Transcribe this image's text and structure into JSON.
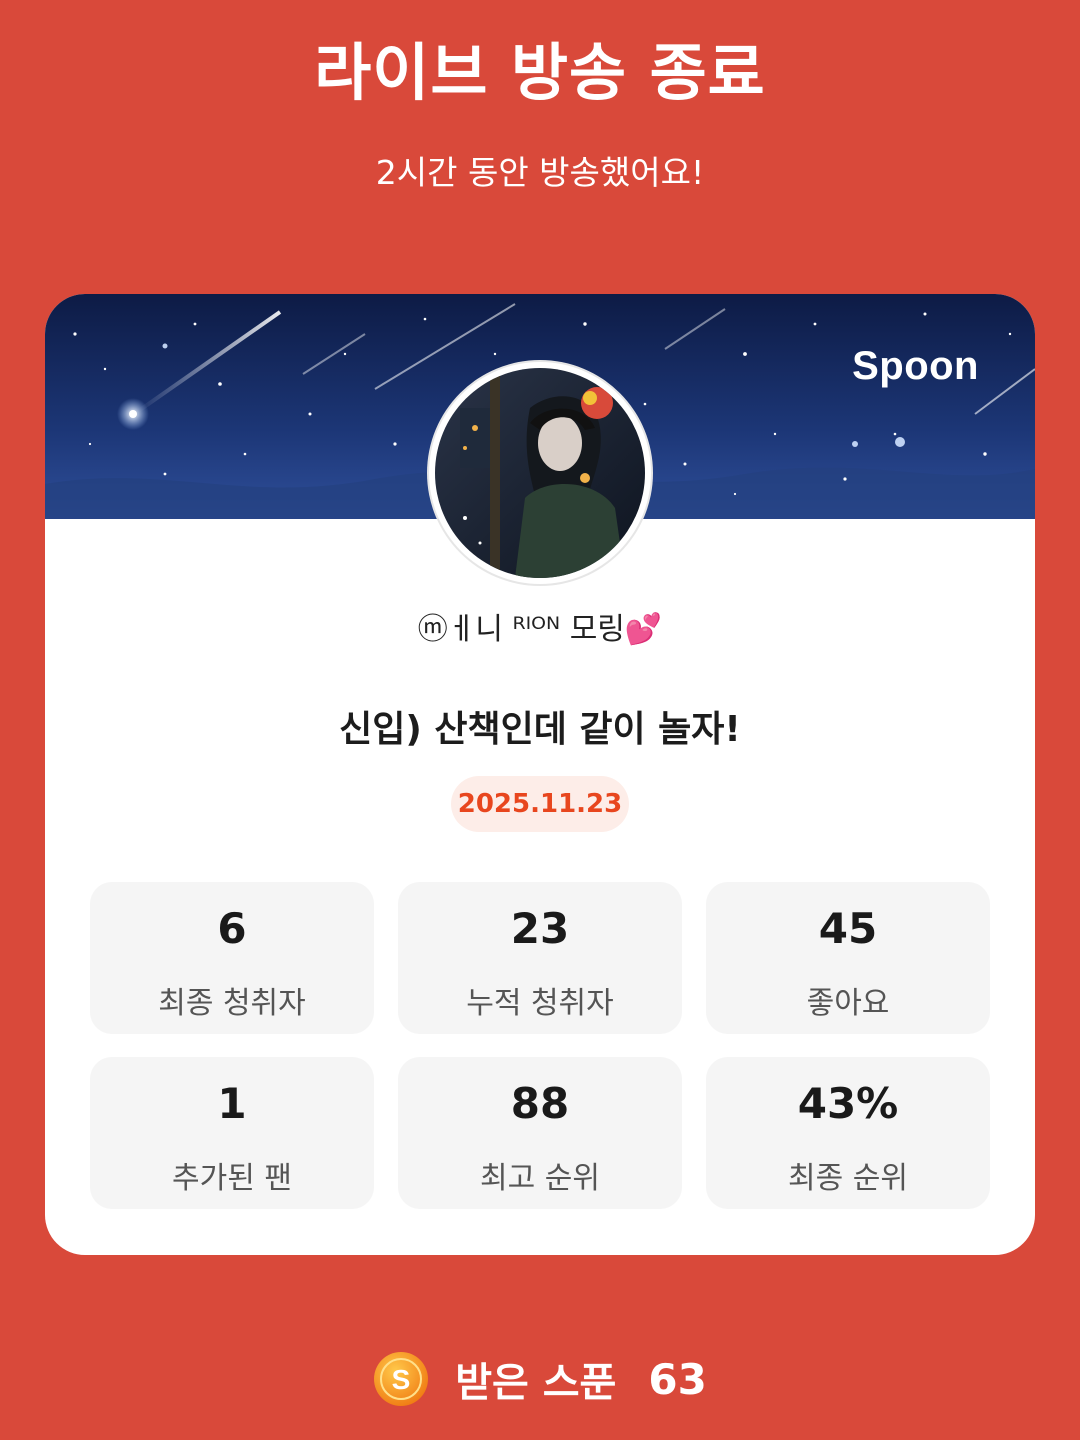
{
  "header": {
    "title": "라이브 방송 종료",
    "subtitle": "2시간 동안 방송했어요!"
  },
  "card": {
    "brand": "Spoon",
    "nickname": "ⓜㅔ니 ᴿᴵᴼᴺ 모링",
    "nickname_emoji": "💕",
    "live_title": "신입) 산책인데 같이 놀자!",
    "date": "2025.11.23",
    "stats": [
      {
        "value": "6",
        "label": "최종 청취자"
      },
      {
        "value": "23",
        "label": "누적 청취자"
      },
      {
        "value": "45",
        "label": "좋아요"
      },
      {
        "value": "1",
        "label": "추가된 팬"
      },
      {
        "value": "88",
        "label": "최고 순위"
      },
      {
        "value": "43%",
        "label": "최종 순위"
      }
    ]
  },
  "footer": {
    "coin_icon": "spoon-coin-icon",
    "label": "받은 스푼",
    "count": "63"
  },
  "colors": {
    "background": "#D9493A",
    "accent": "#E8461E",
    "badge_bg": "#FDEDE8",
    "stat_bg": "#F5F5F5"
  }
}
